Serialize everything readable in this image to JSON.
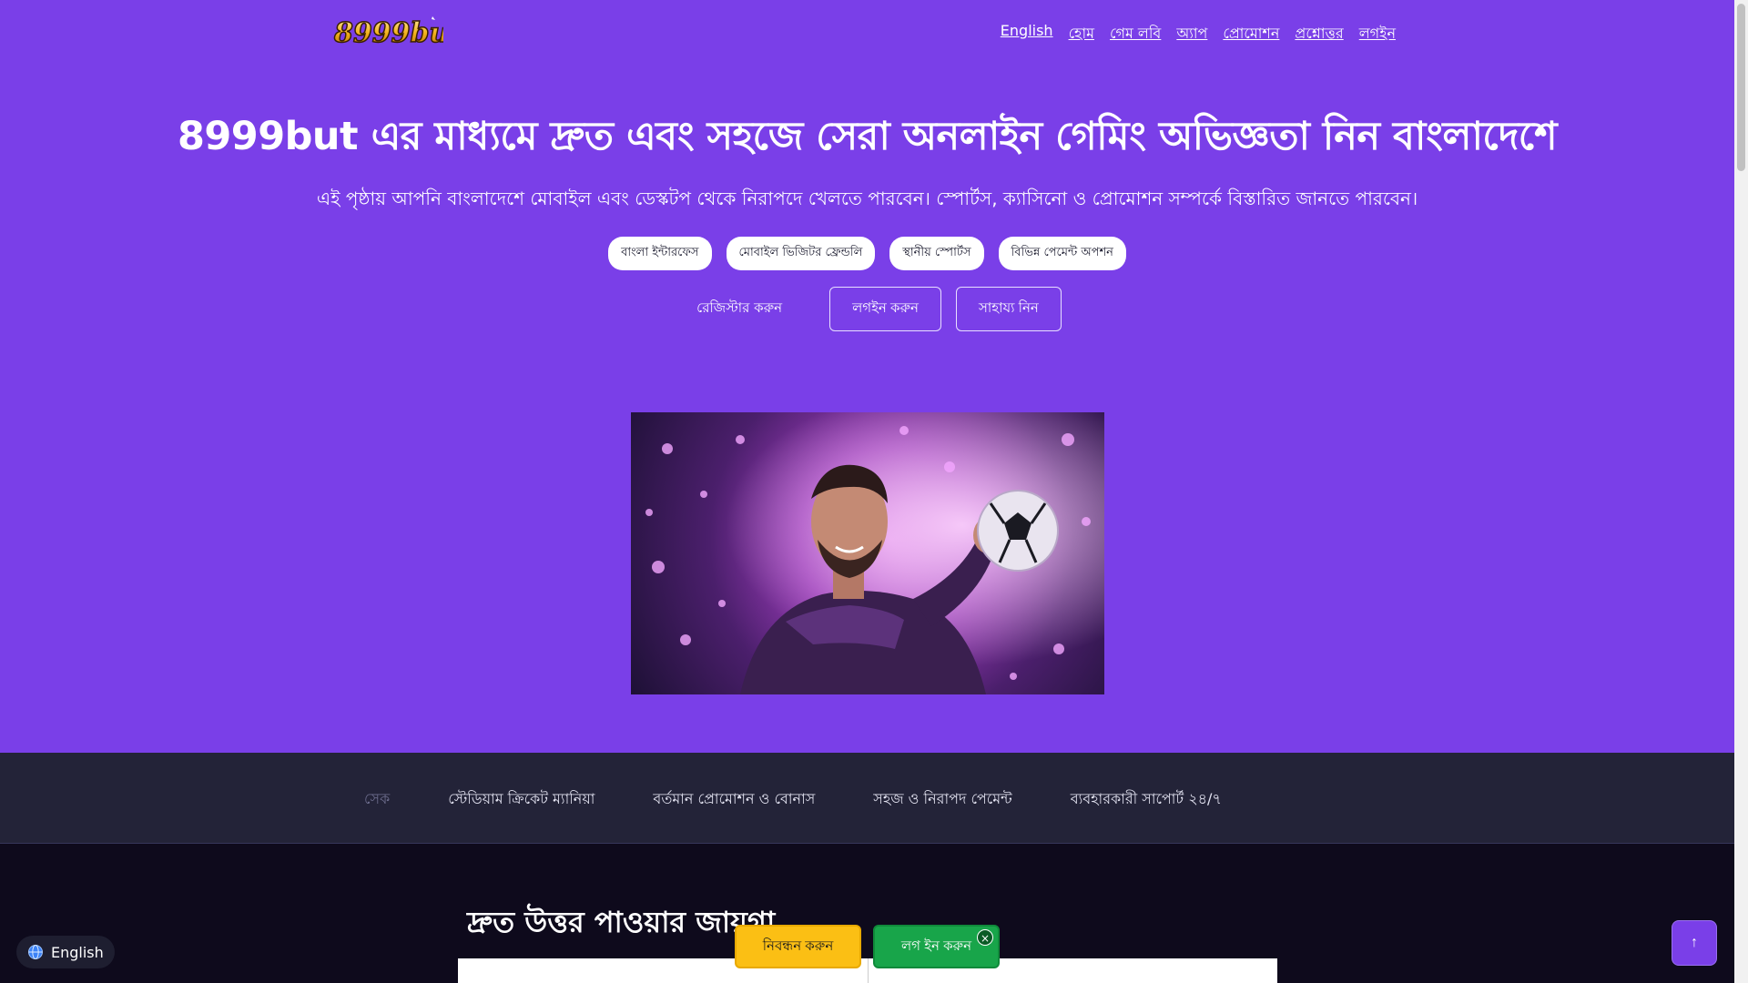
{
  "brand": {
    "logo_text": "8999but"
  },
  "nav": {
    "items": [
      "English",
      "হোম",
      "গেম লবি",
      "অ্যাপ",
      "প্রোমোশন",
      "প্রশ্নোত্তর",
      "লগইন"
    ]
  },
  "hero": {
    "title": "8999but এর মাধ্যমে দ্রুত এবং সহজে সেরা অনলাইন গেমিং অভিজ্ঞতা নিন বাংলাদেশে",
    "subtitle": "এই পৃষ্ঠায় আপনি বাংলাদেশে মোবাইল এবং ডেস্কটপ থেকে নিরাপদে খেলতে পারবেন। স্পোর্টস, ক্যাসিনো ও প্রোমোশন সম্পর্কে বিস্তারিত জানতে পারবেন।",
    "chips": [
      "বাংলা ইন্টারফেস",
      "মোবাইল ভিজিটর ফ্রেন্ডলি",
      "স্থানীয় স্পোর্টস",
      "বিভিন্ন পেমেন্ট অপশন"
    ],
    "register_link": "রেজিস্টার করুন",
    "login_button": "লগইন করুন",
    "help_button": "সাহায্য নিন"
  },
  "ticker": {
    "items": [
      "সেক",
      "স্টেডিয়াম ক্রিকেট ম্যানিয়া",
      "বর্তমান প্রোমোশন ও বোনাস",
      "সহজ ও নিরাপদ পেমেন্ট",
      "ব্যবহারকারী সাপোর্ট ২৪/৭"
    ]
  },
  "section": {
    "title": "দ্রুত উত্তর পাওয়ার জায়গা"
  },
  "floating": {
    "language": "English",
    "register": "নিবন্ধন করুন",
    "login": "লগ ইন করুন",
    "close": "×",
    "back_to_top": "↑"
  },
  "colors": {
    "hero_bg": "#7a3fe8",
    "ticker_bg": "#232338",
    "page_bg": "#0e0a1c",
    "register_btn": "#fbbf14",
    "login_btn": "#18a54a"
  }
}
